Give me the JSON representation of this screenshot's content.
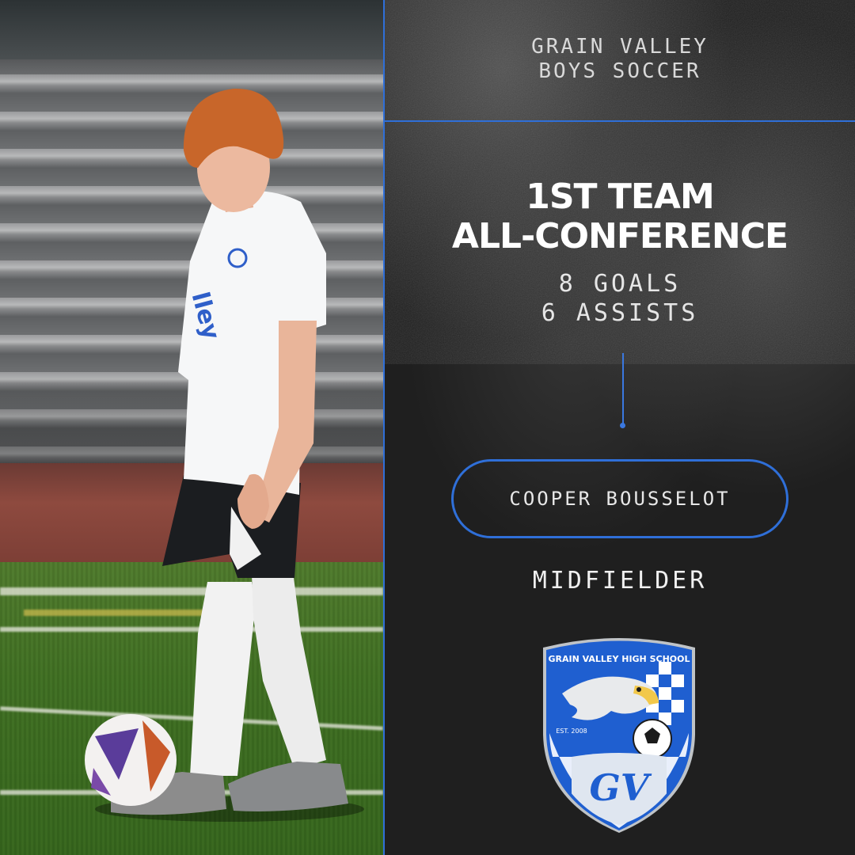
{
  "header": {
    "school_line1": "GRAIN VALLEY",
    "school_line2": "BOYS SOCCER"
  },
  "honor": {
    "line1": "1ST TEAM",
    "line2": "ALL-CONFERENCE"
  },
  "stats": {
    "goals": "8 GOALS",
    "assists": "6 ASSISTS"
  },
  "player": {
    "name": "COOPER BOUSSELOT",
    "position": "MIDFIELDER"
  },
  "crest": {
    "top_text": "GRAIN VALLEY HIGH SCHOOL",
    "est": "EST. 2008",
    "monogram": "GV"
  },
  "colors": {
    "accent_blue": "#2f6fd8",
    "background": "#1e1e1e",
    "text": "#ffffff"
  }
}
